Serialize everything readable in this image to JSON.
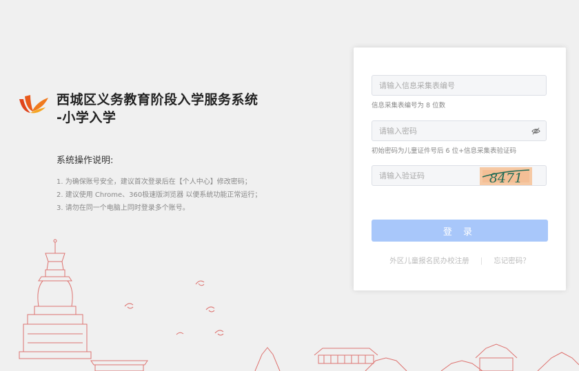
{
  "brand": {
    "title_line1": "西城区义务教育阶段入学服务系统",
    "title_line2": "-小学入学",
    "logo_icon": "feather-logo-icon",
    "logo_colors": [
      "#e0441c",
      "#f07a1e",
      "#f5a623"
    ]
  },
  "guide": {
    "title": "系统操作说明:",
    "items": [
      "1. 为确保账号安全，建议首次登录后在【个人中心】修改密码；",
      "2. 建议使用 Chrome、360极速版浏览器 以便系统功能正常运行；",
      "3. 请勿在同一个电脑上同时登录多个账号。"
    ]
  },
  "form": {
    "form_no": {
      "placeholder": "请输入信息采集表编号",
      "hint": "信息采集表编号为 8 位数"
    },
    "password": {
      "placeholder": "请输入密码",
      "hint": "初始密码为儿童证件号后 6 位+信息采集表验证码",
      "toggle_icon": "eye-slash-icon"
    },
    "captcha": {
      "placeholder": "请输入验证码",
      "image_text": "8471"
    },
    "login_label": "登 录",
    "register_link": "外区儿童报名民办校注册",
    "separator": "|",
    "forgot_link": "忘记密码？"
  },
  "colors": {
    "accent": "#a8c7fa",
    "line_art": "#d9534f",
    "background": "#f0f0f0"
  }
}
